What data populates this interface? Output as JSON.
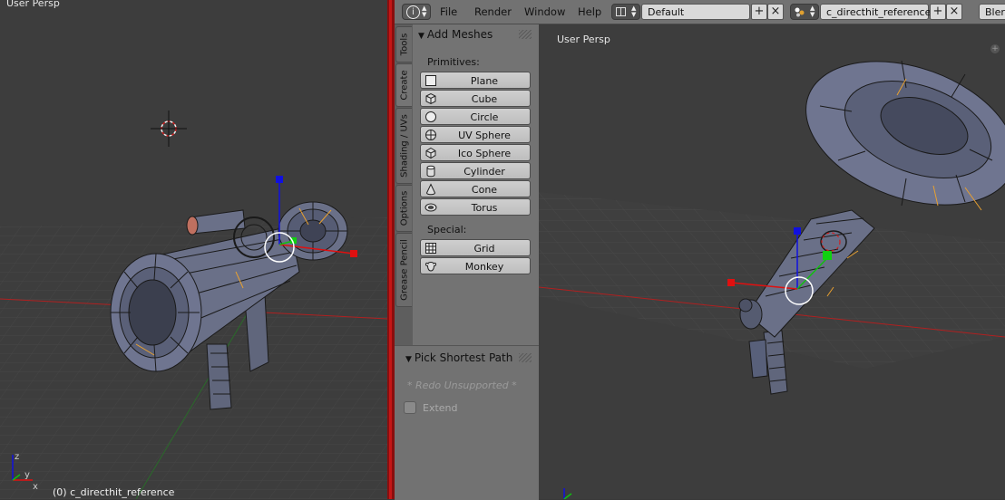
{
  "left_view": {
    "label": "User Persp",
    "object_label": "(0) c_directhit_reference",
    "axis_labels": {
      "x": "x",
      "y": "y",
      "z": "z"
    }
  },
  "right_view": {
    "label": "User Persp"
  },
  "header": {
    "menu": [
      "File",
      "Render",
      "Window",
      "Help"
    ],
    "screen_layout": "Default",
    "scene": "c_directhit_reference",
    "render_engine": "Bler"
  },
  "tool_tabs": [
    "Tools",
    "Create",
    "Shading / UVs",
    "Options",
    "Grease Pencil"
  ],
  "active_tab": "Create",
  "add_meshes": {
    "title": "Add Meshes",
    "primitives_label": "Primitives:",
    "primitives": [
      {
        "label": "Plane",
        "icon": "plane-icon"
      },
      {
        "label": "Cube",
        "icon": "cube-icon"
      },
      {
        "label": "Circle",
        "icon": "circle-icon"
      },
      {
        "label": "UV Sphere",
        "icon": "uv-sphere-icon"
      },
      {
        "label": "Ico Sphere",
        "icon": "ico-sphere-icon"
      },
      {
        "label": "Cylinder",
        "icon": "cylinder-icon"
      },
      {
        "label": "Cone",
        "icon": "cone-icon"
      },
      {
        "label": "Torus",
        "icon": "torus-icon"
      }
    ],
    "special_label": "Special:",
    "special": [
      {
        "label": "Grid",
        "icon": "grid-icon"
      },
      {
        "label": "Monkey",
        "icon": "monkey-icon"
      }
    ]
  },
  "redo_panel": {
    "title": "Pick Shortest Path",
    "note": "* Redo Unsupported *",
    "extend_label": "Extend",
    "extend_checked": false
  },
  "colors": {
    "separator": "#c41616",
    "wire": "#1a1a1a",
    "mesh": "#6a7088",
    "seam": "#e8a030",
    "axis_x": "#e01010",
    "axis_y": "#10c010",
    "axis_z": "#1010e0"
  }
}
